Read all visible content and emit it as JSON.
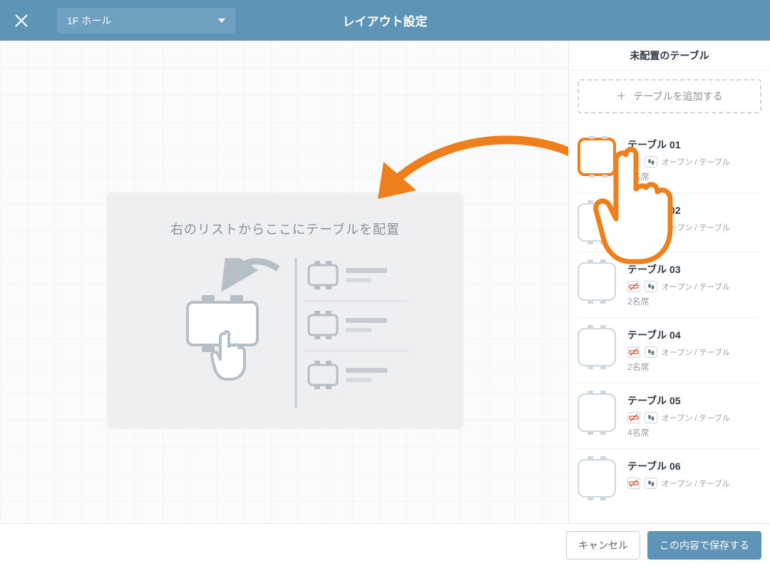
{
  "header": {
    "floor_label": "1F ホール",
    "title": "レイアウト設定"
  },
  "canvas": {
    "placeholder_text": "右のリストからここにテーブルを配置"
  },
  "sidebar": {
    "title": "未配置のテーブル",
    "add_label": "テーブルを追加する",
    "items": [
      {
        "name": "テーブル 01",
        "type": "オープン / テーブル",
        "seats": "2名席",
        "highlight": true
      },
      {
        "name": "テーブル 02",
        "type": "オープン / テーブル",
        "seats": "",
        "highlight": false
      },
      {
        "name": "テーブル 03",
        "type": "オープン / テーブル",
        "seats": "2名席",
        "highlight": false
      },
      {
        "name": "テーブル 04",
        "type": "オープン / テーブル",
        "seats": "2名席",
        "highlight": false
      },
      {
        "name": "テーブル 05",
        "type": "オープン / テーブル",
        "seats": "4名席",
        "highlight": false
      },
      {
        "name": "テーブル 06",
        "type": "オープン / テーブル",
        "seats": "",
        "highlight": false
      }
    ]
  },
  "footer": {
    "cancel": "キャンセル",
    "save": "この内容で保存する"
  },
  "colors": {
    "primary": "#5e94b6",
    "accent": "#ef7f1a"
  }
}
